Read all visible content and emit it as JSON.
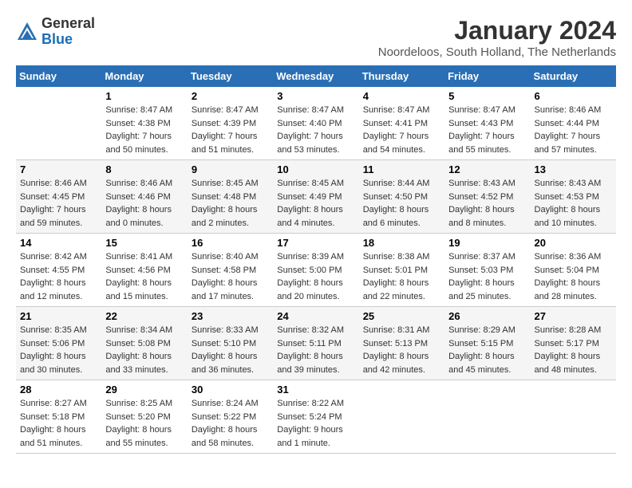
{
  "header": {
    "logo_line1": "General",
    "logo_line2": "Blue",
    "month": "January 2024",
    "location": "Noordeloos, South Holland, The Netherlands"
  },
  "days_of_week": [
    "Sunday",
    "Monday",
    "Tuesday",
    "Wednesday",
    "Thursday",
    "Friday",
    "Saturday"
  ],
  "weeks": [
    [
      {
        "day": "",
        "sunrise": "",
        "sunset": "",
        "daylight": ""
      },
      {
        "day": "1",
        "sunrise": "Sunrise: 8:47 AM",
        "sunset": "Sunset: 4:38 PM",
        "daylight": "Daylight: 7 hours and 50 minutes."
      },
      {
        "day": "2",
        "sunrise": "Sunrise: 8:47 AM",
        "sunset": "Sunset: 4:39 PM",
        "daylight": "Daylight: 7 hours and 51 minutes."
      },
      {
        "day": "3",
        "sunrise": "Sunrise: 8:47 AM",
        "sunset": "Sunset: 4:40 PM",
        "daylight": "Daylight: 7 hours and 53 minutes."
      },
      {
        "day": "4",
        "sunrise": "Sunrise: 8:47 AM",
        "sunset": "Sunset: 4:41 PM",
        "daylight": "Daylight: 7 hours and 54 minutes."
      },
      {
        "day": "5",
        "sunrise": "Sunrise: 8:47 AM",
        "sunset": "Sunset: 4:43 PM",
        "daylight": "Daylight: 7 hours and 55 minutes."
      },
      {
        "day": "6",
        "sunrise": "Sunrise: 8:46 AM",
        "sunset": "Sunset: 4:44 PM",
        "daylight": "Daylight: 7 hours and 57 minutes."
      }
    ],
    [
      {
        "day": "7",
        "sunrise": "Sunrise: 8:46 AM",
        "sunset": "Sunset: 4:45 PM",
        "daylight": "Daylight: 7 hours and 59 minutes."
      },
      {
        "day": "8",
        "sunrise": "Sunrise: 8:46 AM",
        "sunset": "Sunset: 4:46 PM",
        "daylight": "Daylight: 8 hours and 0 minutes."
      },
      {
        "day": "9",
        "sunrise": "Sunrise: 8:45 AM",
        "sunset": "Sunset: 4:48 PM",
        "daylight": "Daylight: 8 hours and 2 minutes."
      },
      {
        "day": "10",
        "sunrise": "Sunrise: 8:45 AM",
        "sunset": "Sunset: 4:49 PM",
        "daylight": "Daylight: 8 hours and 4 minutes."
      },
      {
        "day": "11",
        "sunrise": "Sunrise: 8:44 AM",
        "sunset": "Sunset: 4:50 PM",
        "daylight": "Daylight: 8 hours and 6 minutes."
      },
      {
        "day": "12",
        "sunrise": "Sunrise: 8:43 AM",
        "sunset": "Sunset: 4:52 PM",
        "daylight": "Daylight: 8 hours and 8 minutes."
      },
      {
        "day": "13",
        "sunrise": "Sunrise: 8:43 AM",
        "sunset": "Sunset: 4:53 PM",
        "daylight": "Daylight: 8 hours and 10 minutes."
      }
    ],
    [
      {
        "day": "14",
        "sunrise": "Sunrise: 8:42 AM",
        "sunset": "Sunset: 4:55 PM",
        "daylight": "Daylight: 8 hours and 12 minutes."
      },
      {
        "day": "15",
        "sunrise": "Sunrise: 8:41 AM",
        "sunset": "Sunset: 4:56 PM",
        "daylight": "Daylight: 8 hours and 15 minutes."
      },
      {
        "day": "16",
        "sunrise": "Sunrise: 8:40 AM",
        "sunset": "Sunset: 4:58 PM",
        "daylight": "Daylight: 8 hours and 17 minutes."
      },
      {
        "day": "17",
        "sunrise": "Sunrise: 8:39 AM",
        "sunset": "Sunset: 5:00 PM",
        "daylight": "Daylight: 8 hours and 20 minutes."
      },
      {
        "day": "18",
        "sunrise": "Sunrise: 8:38 AM",
        "sunset": "Sunset: 5:01 PM",
        "daylight": "Daylight: 8 hours and 22 minutes."
      },
      {
        "day": "19",
        "sunrise": "Sunrise: 8:37 AM",
        "sunset": "Sunset: 5:03 PM",
        "daylight": "Daylight: 8 hours and 25 minutes."
      },
      {
        "day": "20",
        "sunrise": "Sunrise: 8:36 AM",
        "sunset": "Sunset: 5:04 PM",
        "daylight": "Daylight: 8 hours and 28 minutes."
      }
    ],
    [
      {
        "day": "21",
        "sunrise": "Sunrise: 8:35 AM",
        "sunset": "Sunset: 5:06 PM",
        "daylight": "Daylight: 8 hours and 30 minutes."
      },
      {
        "day": "22",
        "sunrise": "Sunrise: 8:34 AM",
        "sunset": "Sunset: 5:08 PM",
        "daylight": "Daylight: 8 hours and 33 minutes."
      },
      {
        "day": "23",
        "sunrise": "Sunrise: 8:33 AM",
        "sunset": "Sunset: 5:10 PM",
        "daylight": "Daylight: 8 hours and 36 minutes."
      },
      {
        "day": "24",
        "sunrise": "Sunrise: 8:32 AM",
        "sunset": "Sunset: 5:11 PM",
        "daylight": "Daylight: 8 hours and 39 minutes."
      },
      {
        "day": "25",
        "sunrise": "Sunrise: 8:31 AM",
        "sunset": "Sunset: 5:13 PM",
        "daylight": "Daylight: 8 hours and 42 minutes."
      },
      {
        "day": "26",
        "sunrise": "Sunrise: 8:29 AM",
        "sunset": "Sunset: 5:15 PM",
        "daylight": "Daylight: 8 hours and 45 minutes."
      },
      {
        "day": "27",
        "sunrise": "Sunrise: 8:28 AM",
        "sunset": "Sunset: 5:17 PM",
        "daylight": "Daylight: 8 hours and 48 minutes."
      }
    ],
    [
      {
        "day": "28",
        "sunrise": "Sunrise: 8:27 AM",
        "sunset": "Sunset: 5:18 PM",
        "daylight": "Daylight: 8 hours and 51 minutes."
      },
      {
        "day": "29",
        "sunrise": "Sunrise: 8:25 AM",
        "sunset": "Sunset: 5:20 PM",
        "daylight": "Daylight: 8 hours and 55 minutes."
      },
      {
        "day": "30",
        "sunrise": "Sunrise: 8:24 AM",
        "sunset": "Sunset: 5:22 PM",
        "daylight": "Daylight: 8 hours and 58 minutes."
      },
      {
        "day": "31",
        "sunrise": "Sunrise: 8:22 AM",
        "sunset": "Sunset: 5:24 PM",
        "daylight": "Daylight: 9 hours and 1 minute."
      },
      {
        "day": "",
        "sunrise": "",
        "sunset": "",
        "daylight": ""
      },
      {
        "day": "",
        "sunrise": "",
        "sunset": "",
        "daylight": ""
      },
      {
        "day": "",
        "sunrise": "",
        "sunset": "",
        "daylight": ""
      }
    ]
  ]
}
